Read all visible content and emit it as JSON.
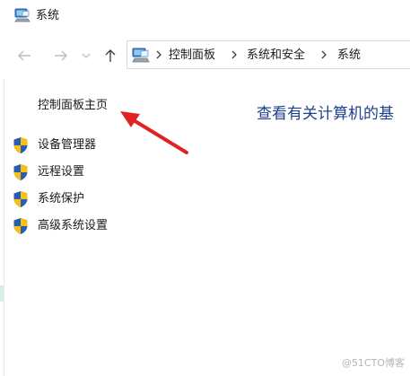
{
  "window": {
    "title": "系统",
    "title_icon": "system-monitor-icon"
  },
  "navigation": {
    "back_icon": "back-arrow-icon",
    "forward_icon": "forward-arrow-icon",
    "recent_icon": "chevron-down-icon",
    "up_icon": "up-arrow-icon",
    "address_icon": "control-panel-icon",
    "breadcrumb": [
      "控制面板",
      "系统和安全",
      "系统"
    ]
  },
  "sidebar": {
    "home_link": "控制面板主页",
    "items": [
      {
        "label": "设备管理器",
        "icon": "shield-icon"
      },
      {
        "label": "远程设置",
        "icon": "shield-icon"
      },
      {
        "label": "系统保护",
        "icon": "shield-icon"
      },
      {
        "label": "高级系统设置",
        "icon": "shield-icon"
      }
    ]
  },
  "main": {
    "heading": "查看有关计算机的基"
  },
  "annotation": {
    "arrow_color": "#e02222"
  },
  "watermark": "@51CTO博客",
  "colors": {
    "heading": "#1e3f8f",
    "shield_blue": "#2a5db0",
    "shield_yellow": "#f5c116"
  }
}
